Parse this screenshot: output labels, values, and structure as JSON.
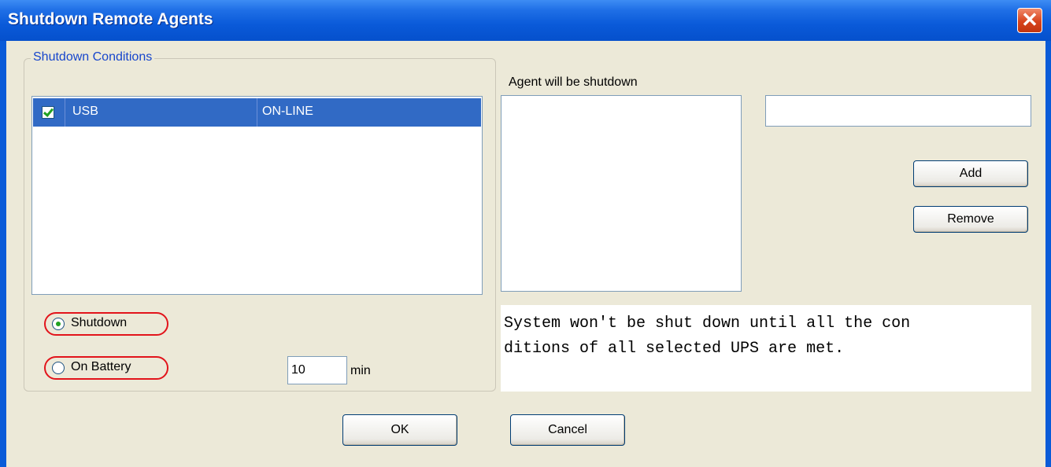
{
  "window": {
    "title": "Shutdown Remote Agents",
    "close_glyph": "✕"
  },
  "conditions": {
    "legend": "Shutdown Conditions",
    "rows": [
      {
        "checked": true,
        "name": "USB",
        "status": "ON-LINE"
      }
    ],
    "radio_shutdown": "Shutdown",
    "radio_on_battery": "On Battery",
    "selected_radio": "Shutdown",
    "minutes_value": "10",
    "minutes_unit": "min"
  },
  "agents": {
    "label": "Agent will be shutdown",
    "input_value": "",
    "add_label": "Add",
    "remove_label": "Remove"
  },
  "note": {
    "line1": "System won't be shut down until all the con",
    "line2": "ditions of all selected UPS are met."
  },
  "footer": {
    "ok_label": "OK",
    "cancel_label": "Cancel"
  },
  "colors": {
    "title_bar": "#0a5ad9",
    "selection": "#316ac5",
    "highlight_ring": "#e2141b",
    "client_bg": "#ece9d8"
  }
}
